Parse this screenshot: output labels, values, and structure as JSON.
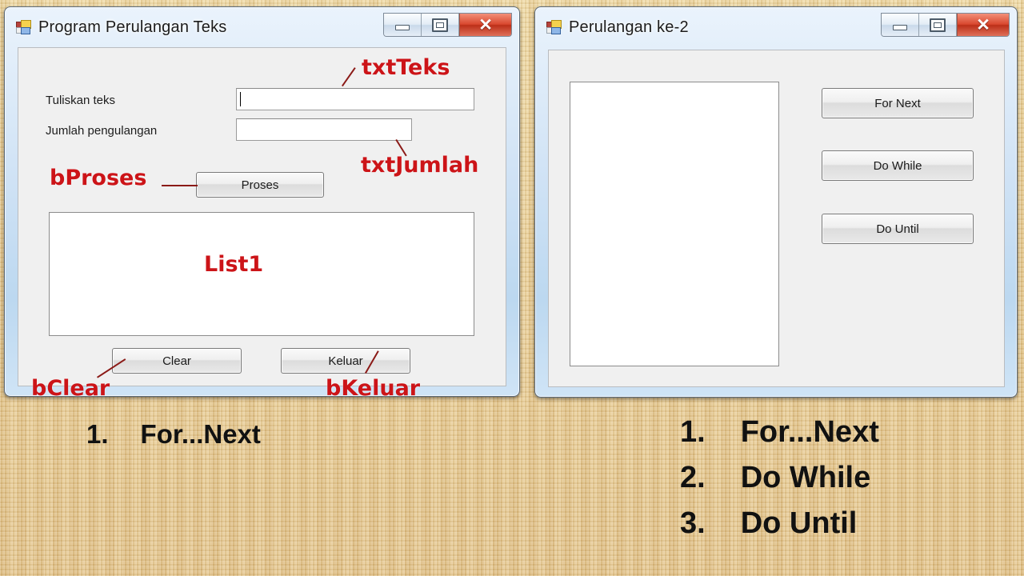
{
  "background": {
    "color": "#e7c98b",
    "texture": "woven-fabric"
  },
  "annotation_color": "#cc1418",
  "windows": [
    {
      "id": "left",
      "title": "Program Perulangan Teks",
      "icon": "vb-form-icon",
      "controls": {
        "minimize_label": "Minimize",
        "maximize_label": "Maximize",
        "close_label": "✕"
      },
      "fields": [
        {
          "label": "Tuliskan teks",
          "value": "",
          "name": "txtTeks",
          "focused": true
        },
        {
          "label": "Jumlah pengulangan",
          "value": "",
          "name": "txtJumlah",
          "focused": false
        }
      ],
      "buttons": [
        {
          "label": "Proses",
          "name": "bProses"
        },
        {
          "label": "Clear",
          "name": "bClear"
        },
        {
          "label": "Keluar",
          "name": "bKeluar"
        }
      ],
      "list": {
        "name": "List1",
        "items": []
      },
      "annotations": [
        {
          "text": "txtTeks"
        },
        {
          "text": "txtJumlah"
        },
        {
          "text": "bProses"
        },
        {
          "text": "List1"
        },
        {
          "text": "bClear"
        },
        {
          "text": "bKeluar"
        }
      ]
    },
    {
      "id": "right",
      "title": "Perulangan ke-2",
      "icon": "vb-form-icon",
      "controls": {
        "minimize_label": "Minimize",
        "maximize_label": "Maximize",
        "close_label": "✕"
      },
      "list": {
        "items": []
      },
      "buttons": [
        {
          "label": "For Next"
        },
        {
          "label": "Do While"
        },
        {
          "label": "Do Until"
        }
      ]
    }
  ],
  "bottom_lists": [
    {
      "id": "left-list",
      "items": [
        {
          "num": "1.",
          "text": "For...Next"
        }
      ]
    },
    {
      "id": "right-list",
      "items": [
        {
          "num": "1.",
          "text": "For...Next"
        },
        {
          "num": "2.",
          "text": "Do While"
        },
        {
          "num": "3.",
          "text": "Do Until"
        }
      ]
    }
  ]
}
